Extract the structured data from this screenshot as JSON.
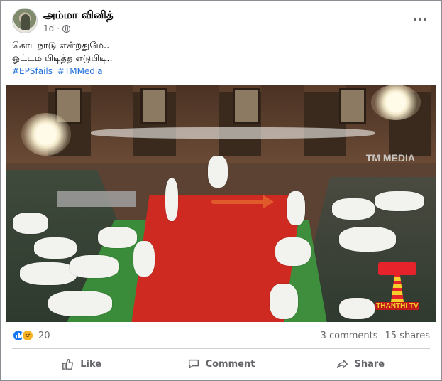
{
  "post": {
    "author": "அம்மா வினித்",
    "time": "1d",
    "privacy_icon": "globe-icon",
    "text_line1": "கொடநாடு என்றதுமே..",
    "text_line2": "ஓட்டம் பிடித்த எடுபிடி..",
    "hashtags": [
      "#EPSfails",
      "#TMMedia"
    ]
  },
  "video": {
    "watermark": "TM MEDIA",
    "channel_logo_text": "THANTHI TV"
  },
  "reactions": {
    "icons": [
      "like-icon",
      "haha-icon"
    ],
    "count": "20",
    "comments": "3 comments",
    "shares": "15 shares"
  },
  "actions": {
    "like": "Like",
    "comment": "Comment",
    "share": "Share"
  },
  "colors": {
    "hashtag": "#216fdb",
    "secondary_text": "#65676b",
    "like_blue": "#1877f2"
  }
}
